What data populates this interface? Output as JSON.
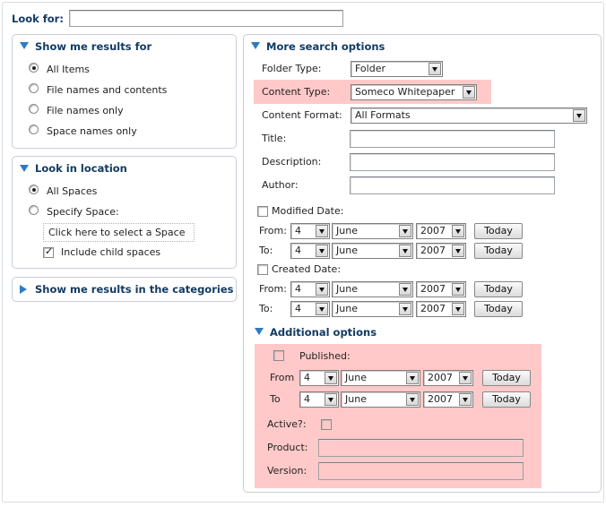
{
  "look_for": {
    "label": "Look for:",
    "value": ""
  },
  "results_for": {
    "title": "Show me results for",
    "options": [
      {
        "label": "All Items",
        "selected": true
      },
      {
        "label": "File names and contents",
        "selected": false
      },
      {
        "label": "File names only",
        "selected": false
      },
      {
        "label": "Space names only",
        "selected": false
      }
    ]
  },
  "location": {
    "title": "Look in location",
    "options": [
      {
        "label": "All Spaces",
        "selected": true
      },
      {
        "label": "Specify Space:",
        "selected": false
      }
    ],
    "select_space_link": "Click here to select a Space",
    "include_child": {
      "label": "Include child spaces",
      "checked": true
    }
  },
  "categories": {
    "title": "Show me results in the categories"
  },
  "more_options": {
    "title": "More search options",
    "folder_type": {
      "label": "Folder Type:",
      "value": "Folder"
    },
    "content_type": {
      "label": "Content Type:",
      "value": "Someco Whitepaper"
    },
    "content_format": {
      "label": "Content Format:",
      "value": "All Formats"
    },
    "title_field": {
      "label": "Title:",
      "value": ""
    },
    "description_field": {
      "label": "Description:",
      "value": ""
    },
    "author_field": {
      "label": "Author:",
      "value": ""
    },
    "modified_date": {
      "label": "Modified Date:",
      "checked": false,
      "from": {
        "label": "From:",
        "day": "4",
        "month": "June",
        "year": "2007",
        "today": "Today"
      },
      "to": {
        "label": "To:",
        "day": "4",
        "month": "June",
        "year": "2007",
        "today": "Today"
      }
    },
    "created_date": {
      "label": "Created Date:",
      "checked": false,
      "from": {
        "label": "From:",
        "day": "4",
        "month": "June",
        "year": "2007",
        "today": "Today"
      },
      "to": {
        "label": "To:",
        "day": "4",
        "month": "June",
        "year": "2007",
        "today": "Today"
      }
    }
  },
  "additional": {
    "title": "Additional options",
    "published": {
      "label": "Published:",
      "checked": false,
      "from": {
        "label": "From",
        "day": "4",
        "month": "June",
        "year": "2007",
        "today": "Today"
      },
      "to": {
        "label": "To",
        "day": "4",
        "month": "June",
        "year": "2007",
        "today": "Today"
      }
    },
    "active": {
      "label": "Active?:",
      "checked": false
    },
    "product": {
      "label": "Product:",
      "value": ""
    },
    "version": {
      "label": "Version:",
      "value": ""
    }
  },
  "colors": {
    "heading": "#123b63",
    "accent": "#2c7cc2",
    "highlight": "#ffc9c9"
  }
}
